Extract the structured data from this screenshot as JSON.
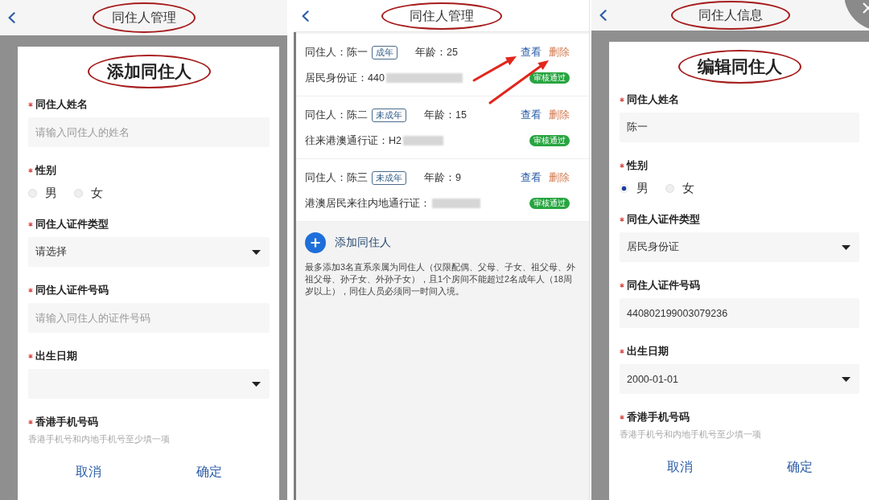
{
  "panels": [
    {
      "kind": "form",
      "header": {
        "title": "同住人管理",
        "circled": true
      },
      "modal": {
        "title": "添加同住人",
        "circled": true,
        "fields": [
          {
            "kind": "text",
            "label": "同住人姓名",
            "required": true,
            "placeholder": "请输入同住人的姓名"
          },
          {
            "kind": "radio",
            "label": "性别",
            "required": true,
            "options": [
              {
                "label": "男",
                "selected": false
              },
              {
                "label": "女",
                "selected": false
              }
            ]
          },
          {
            "kind": "select",
            "label": "同住人证件类型",
            "required": true,
            "value": "请选择"
          },
          {
            "kind": "text",
            "label": "同住人证件号码",
            "required": true,
            "placeholder": "请输入同住人的证件号码"
          },
          {
            "kind": "select",
            "label": "出生日期",
            "required": true
          },
          {
            "kind": "note",
            "label": "香港手机号码",
            "required": true,
            "hint": "香港手机号和内地手机号至少填一项"
          }
        ],
        "buttons": [
          "取消",
          "确定"
        ]
      }
    },
    {
      "kind": "list",
      "header": {
        "title": "同住人管理",
        "circled": true
      },
      "rows": [
        {
          "name": "同住人：陈一",
          "tag": "成年",
          "age": "年龄：25",
          "document": "居民身份证：440",
          "redacted": true,
          "status": "审核通过",
          "actions": [
            {
              "kind": "view",
              "label": "查看",
              "pointed": true
            },
            {
              "kind": "delete",
              "label": "删除",
              "pointed": true
            }
          ]
        },
        {
          "name": "同住人：陈二",
          "tag": "未成年",
          "age": "年龄：15",
          "document": "往来港澳通行证：H2",
          "redacted": true,
          "status": "审核通过",
          "actions": [
            {
              "kind": "view",
              "label": "查看",
              "pointed": false
            },
            {
              "kind": "delete",
              "label": "删除",
              "pointed": false
            }
          ]
        },
        {
          "name": "同住人：陈三",
          "tag": "未成年",
          "age": "年龄：9",
          "document": "港澳居民来往内地通行证：",
          "redacted": true,
          "status": "审核通过",
          "actions": [
            {
              "kind": "view",
              "label": "查看",
              "pointed": false
            },
            {
              "kind": "delete",
              "label": "删除",
              "pointed": false
            }
          ]
        }
      ],
      "add_button": "添加同住人",
      "note": "最多添加3名直系亲属为同住人（仅限配偶、父母、子女、祖父母、外祖父母、孙子女、外孙子女），且1个房间不能超过2名成年人（18周岁以上），同住人员必须同一时间入境。"
    },
    {
      "kind": "form",
      "header": {
        "title": "同住人信息",
        "circled": true
      },
      "close_button": true,
      "modal": {
        "title": "编辑同住人",
        "circled": true,
        "fields": [
          {
            "kind": "text",
            "label": "同住人姓名",
            "required": true,
            "value": "陈一"
          },
          {
            "kind": "radio",
            "label": "性别",
            "required": true,
            "options": [
              {
                "label": "男",
                "selected": true
              },
              {
                "label": "女",
                "selected": false
              }
            ]
          },
          {
            "kind": "select",
            "label": "同住人证件类型",
            "required": true,
            "value": "居民身份证"
          },
          {
            "kind": "text",
            "label": "同住人证件号码",
            "required": true,
            "value": "440802199003079236"
          },
          {
            "kind": "select",
            "label": "出生日期",
            "required": true,
            "value": "2000-01-01"
          },
          {
            "kind": "note",
            "label": "香港手机号码",
            "required": true,
            "hint": "香港手机号和内地手机号至少填一项"
          }
        ],
        "buttons": [
          "取消",
          "确定"
        ]
      }
    }
  ]
}
